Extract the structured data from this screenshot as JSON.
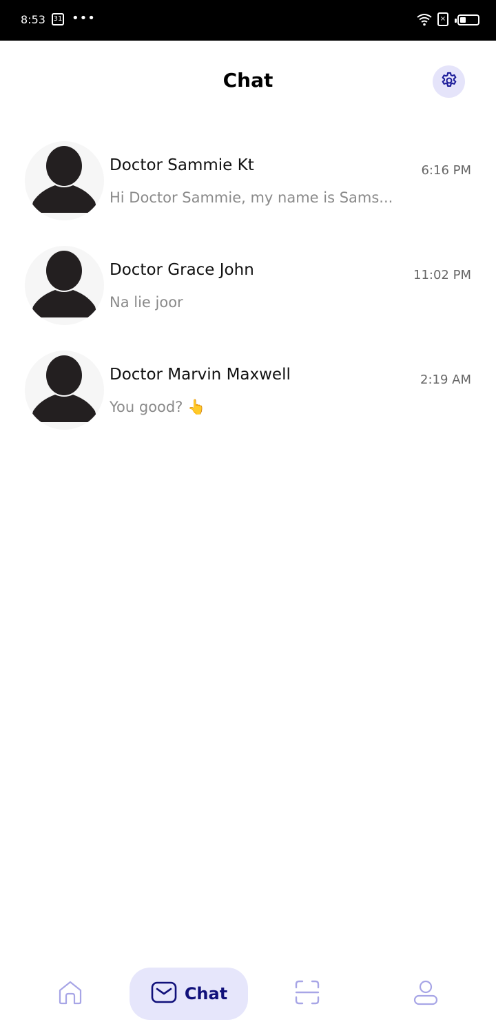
{
  "status_bar": {
    "time": "8:53",
    "calendar_day": "31",
    "more": "•••",
    "sim": "×"
  },
  "header": {
    "title": "Chat",
    "settings_icon": "gear-icon"
  },
  "chats": [
    {
      "name": "Doctor Sammie Kt",
      "preview": "Hi Doctor Sammie, my name is Sams...",
      "time": "6:16 PM"
    },
    {
      "name": "Doctor Grace John",
      "preview": "Na lie joor",
      "time": "11:02 PM"
    },
    {
      "name": "Doctor Marvin Maxwell",
      "preview": "You good? 👆",
      "time": "2:19 AM"
    }
  ],
  "bottom_nav": {
    "home_icon": "home-icon",
    "chat_label": "Chat",
    "chat_icon": "mail-icon",
    "scan_icon": "scan-icon",
    "profile_icon": "user-icon",
    "active_color": "#10107a",
    "inactive_color": "#a7a5e6"
  }
}
